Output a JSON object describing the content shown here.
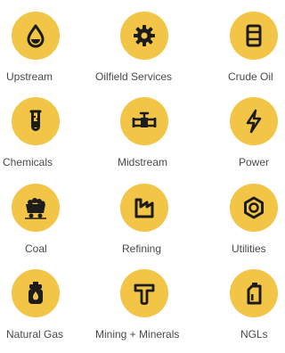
{
  "industries": [
    {
      "label": "Upstream",
      "icon": "oil-drop-icon"
    },
    {
      "label": "Oilfield Services",
      "icon": "gear-icon"
    },
    {
      "label": "Crude Oil",
      "icon": "oil-barrel-icon"
    },
    {
      "label": "Chemicals",
      "icon": "test-tube-icon"
    },
    {
      "label": "Midstream",
      "icon": "pipeline-icon"
    },
    {
      "label": "Power",
      "icon": "lightning-bolt-icon"
    },
    {
      "label": "Coal",
      "icon": "coal-cart-icon"
    },
    {
      "label": "Refining",
      "icon": "refinery-icon"
    },
    {
      "label": "Utilities",
      "icon": "hex-nut-icon"
    },
    {
      "label": "Natural Gas",
      "icon": "gas-cylinder-icon"
    },
    {
      "label": "Mining + Minerals",
      "icon": "hammer-icon"
    },
    {
      "label": "NGLs",
      "icon": "fuel-canister-icon"
    }
  ],
  "colors": {
    "icon_circle": "#f2c547",
    "icon_glyph": "#1c1c1c",
    "label_text": "#4a4a4a"
  }
}
